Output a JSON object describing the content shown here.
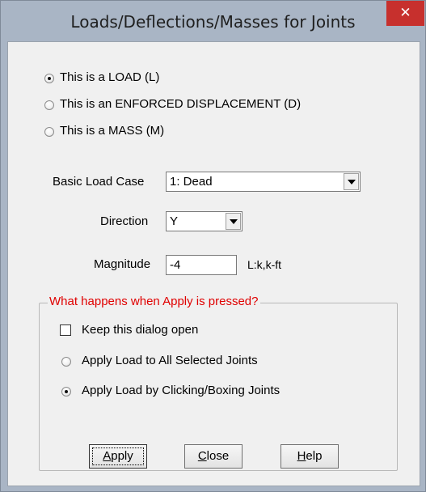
{
  "window": {
    "title": "Loads/Deflections/Masses for Joints",
    "close_glyph": "✕"
  },
  "type_options": [
    {
      "label": "This is a LOAD (L)",
      "checked": true
    },
    {
      "label": "This is an ENFORCED DISPLACEMENT (D)",
      "checked": false
    },
    {
      "label": "This is a MASS (M)",
      "checked": false
    }
  ],
  "fields": {
    "load_case_label": "Basic Load Case",
    "load_case_value": "1: Dead",
    "direction_label": "Direction",
    "direction_value": "Y",
    "magnitude_label": "Magnitude",
    "magnitude_value": "-4",
    "units": "L:k,k-ft"
  },
  "apply_group": {
    "title": "What happens when Apply is pressed?",
    "title_color": "#e00000",
    "keep_open_label": "Keep this dialog open",
    "keep_open_checked": false,
    "options": [
      {
        "label": "Apply Load to All Selected Joints",
        "checked": false
      },
      {
        "label": "Apply Load by Clicking/Boxing Joints",
        "checked": true
      }
    ]
  },
  "buttons": {
    "apply_mnemonic": "A",
    "apply_rest": "pply",
    "close_mnemonic": "C",
    "close_rest": "lose",
    "help_mnemonic": "H",
    "help_rest": "elp"
  },
  "icons": [
    "close-icon",
    "dropdown-arrow-icon",
    "radio-icon",
    "checkbox-icon"
  ],
  "colors": {
    "title_bar": "#a9b5c5",
    "close_button": "#c7302d",
    "dialog_bg": "#f0f0f0"
  }
}
